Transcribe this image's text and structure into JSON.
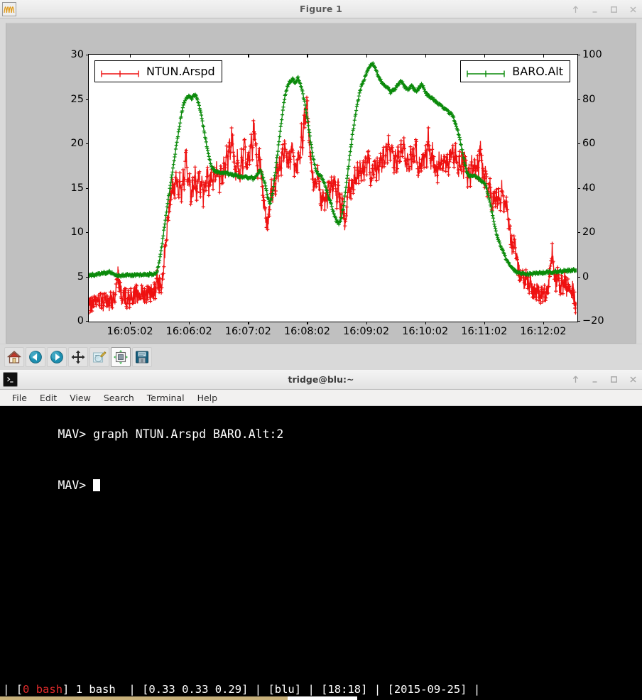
{
  "figure_window": {
    "title": "Figure 1",
    "app_icon": "waveform-icon",
    "controls": [
      "shade-icon",
      "minimize-icon",
      "maximize-icon",
      "close-icon"
    ],
    "toolbar": {
      "buttons": [
        {
          "name": "home-button",
          "icon": "home-icon",
          "tooltip": "Reset original view"
        },
        {
          "name": "back-button",
          "icon": "arrow-left-icon",
          "tooltip": "Back to previous view"
        },
        {
          "name": "forward-button",
          "icon": "arrow-right-icon",
          "tooltip": "Forward to next view"
        },
        {
          "name": "pan-button",
          "icon": "move-cross-icon",
          "tooltip": "Pan axes with left mouse"
        },
        {
          "name": "zoom-button",
          "icon": "zoom-rect-icon",
          "tooltip": "Zoom to rectangle"
        },
        {
          "name": "subplots-button",
          "icon": "configure-subplots-icon",
          "tooltip": "Configure subplots"
        },
        {
          "name": "save-button",
          "icon": "floppy-disk-icon",
          "tooltip": "Save the figure"
        }
      ]
    }
  },
  "chart_data": {
    "type": "line",
    "title": "",
    "xlabel": "",
    "ylabel": "",
    "grid": false,
    "x_tick_labels": [
      "16:05:02",
      "16:06:02",
      "16:07:02",
      "16:08:02",
      "16:09:02",
      "16:10:02",
      "16:11:02",
      "16:12:02"
    ],
    "x_tick_positions": [
      0.0845,
      0.2055,
      0.3265,
      0.4475,
      0.5685,
      0.6895,
      0.8105,
      0.9315
    ],
    "left_axis": {
      "label": "NTUN.Arspd",
      "ticks": [
        0,
        5,
        10,
        15,
        20,
        25,
        30
      ],
      "ylim": [
        0,
        30
      ],
      "color": "#ee1111"
    },
    "right_axis": {
      "label": "BARO.Alt",
      "ticks": [
        -20,
        0,
        20,
        40,
        60,
        80,
        100
      ],
      "ylim": [
        -20,
        100
      ],
      "color": "#0a8a0a"
    },
    "legend": [
      {
        "name": "NTUN.Arspd",
        "color": "#ee1111",
        "position": "upper-left",
        "marker": "plus"
      },
      {
        "name": "BARO.Alt",
        "color": "#0a8a0a",
        "position": "upper-right",
        "marker": "plus"
      }
    ],
    "series": [
      {
        "name": "NTUN.Arspd",
        "axis": "left",
        "color": "#ee1111",
        "marker": "plus",
        "noise": 1.05,
        "values": [
          1.8,
          2.0,
          1.7,
          2.2,
          1.9,
          2.3,
          1.8,
          2.1,
          2.4,
          2.0,
          2.2,
          1.9,
          2.5,
          2.1,
          2.3,
          2.0,
          2.6,
          2.2,
          2.4,
          2.1,
          4.2,
          5.5,
          4.6,
          3.6,
          2.9,
          2.6,
          3.0,
          2.7,
          2.4,
          2.8,
          2.5,
          2.9,
          2.6,
          3.0,
          2.7,
          3.1,
          2.8,
          2.5,
          2.9,
          3.2,
          3.0,
          2.7,
          3.1,
          2.8,
          3.2,
          2.9,
          3.3,
          3.0,
          3.4,
          3.6,
          4.8,
          3.9,
          4.4,
          3.8,
          5.0,
          6.6,
          8.2,
          9.8,
          11.4,
          12.8,
          13.9,
          14.8,
          15.6,
          14.2,
          16.0,
          15.2,
          14.6,
          15.9,
          13.4,
          16.8,
          15.0,
          19.6,
          17.2,
          14.8,
          16.4,
          13.6,
          15.8,
          14.4,
          16.6,
          14.0,
          15.4,
          16.2,
          14.6,
          15.8,
          13.9,
          16.0,
          15.2,
          17.1,
          14.4,
          15.9,
          16.8,
          14.9,
          16.3,
          15.5,
          17.4,
          16.0,
          14.8,
          16.9,
          15.6,
          17.8,
          16.2,
          19.0,
          17.4,
          20.6,
          18.2,
          21.4,
          19.0,
          17.6,
          16.2,
          18.4,
          17.0,
          15.8,
          18.8,
          17.2,
          20.2,
          18.6,
          16.8,
          19.4,
          17.8,
          21.0,
          19.2,
          22.6,
          20.4,
          18.6,
          17.0,
          19.2,
          17.4,
          15.6,
          14.0,
          12.6,
          11.4,
          10.2,
          12.0,
          13.6,
          15.2,
          14.0,
          16.2,
          15.0,
          17.4,
          16.0,
          18.2,
          16.8,
          19.6,
          18.0,
          20.4,
          18.8,
          17.2,
          19.0,
          17.6,
          20.0,
          18.4,
          16.8,
          18.6,
          17.0,
          19.4,
          18.0,
          21.2,
          19.6,
          23.4,
          21.8,
          24.8,
          22.4,
          20.0,
          18.4,
          16.6,
          15.0,
          16.4,
          15.2,
          17.0,
          15.6,
          14.2,
          12.8,
          14.4,
          13.0,
          15.0,
          13.6,
          15.4,
          14.0,
          16.0,
          14.6,
          16.4,
          15.0,
          13.4,
          15.2,
          13.8,
          12.4,
          13.8,
          12.2,
          11.0,
          12.4,
          13.8,
          15.2,
          14.0,
          16.0,
          14.8,
          16.8,
          15.4,
          17.2,
          15.8,
          17.6,
          16.2,
          18.0,
          16.6,
          18.4,
          17.0,
          19.0,
          17.4,
          15.8,
          17.4,
          16.0,
          17.8,
          16.4,
          18.2,
          16.8,
          18.6,
          17.2,
          19.2,
          17.8,
          19.6,
          18.2,
          20.0,
          18.4,
          20.4,
          18.8,
          17.2,
          18.8,
          17.4,
          19.2,
          17.8,
          19.6,
          18.0,
          20.2,
          18.6,
          17.0,
          18.6,
          17.2,
          19.0,
          17.6,
          19.4,
          18.0,
          20.0,
          18.4,
          16.8,
          18.4,
          17.0,
          18.8,
          17.4,
          19.2,
          17.6,
          21.2,
          19.4,
          17.8,
          19.4,
          18.0,
          16.4,
          18.0,
          16.6,
          18.2,
          16.8,
          18.4,
          17.0,
          18.6,
          17.2,
          18.8,
          17.4,
          19.0,
          17.6,
          19.2,
          17.8,
          19.4,
          18.0,
          16.4,
          18.2,
          16.8,
          18.4,
          17.0,
          18.6,
          17.2,
          16.0,
          17.4,
          16.2,
          17.8,
          16.4,
          18.0,
          16.6,
          18.2,
          16.8,
          20.2,
          18.4,
          16.8,
          15.4,
          16.8,
          15.4,
          14.2,
          15.6,
          14.2,
          13.0,
          14.4,
          13.0,
          14.6,
          13.2,
          14.8,
          13.4,
          15.0,
          13.6,
          12.4,
          13.8,
          12.6,
          11.4,
          10.2,
          9.0,
          8.0,
          9.2,
          8.2,
          7.2,
          6.2,
          5.4,
          4.6,
          5.8,
          4.8,
          4.0,
          5.0,
          4.2,
          3.4,
          4.4,
          3.6,
          2.8,
          3.8,
          3.0,
          4.0,
          3.2,
          2.4,
          3.4,
          2.6,
          3.6,
          2.8,
          4.0,
          3.2,
          5.4,
          6.8,
          8.2,
          6.6,
          5.0,
          4.2,
          5.4,
          4.4,
          3.6,
          4.6,
          3.8,
          4.8,
          4.0,
          3.2,
          4.2,
          3.4,
          2.6,
          3.6,
          2.8,
          2.0,
          1.4
        ]
      },
      {
        "name": "BARO.Alt",
        "axis": "right",
        "color": "#0a8a0a",
        "marker": "plus",
        "noise": 0.6,
        "values": [
          0.5,
          0.8,
          0.6,
          1.0,
          0.7,
          1.2,
          0.9,
          1.4,
          1.0,
          1.6,
          1.2,
          1.8,
          1.4,
          2.0,
          1.6,
          2.2,
          1.8,
          1.5,
          1.2,
          1.0,
          0.8,
          0.6,
          0.4,
          0.5,
          0.3,
          0.6,
          0.4,
          0.7,
          0.5,
          0.8,
          0.6,
          0.4,
          0.7,
          0.5,
          0.8,
          0.6,
          0.9,
          0.7,
          1.0,
          0.8,
          0.6,
          0.9,
          0.7,
          1.0,
          0.8,
          1.1,
          0.9,
          1.2,
          1.0,
          1.4,
          2.2,
          4.0,
          7.0,
          11.0,
          15.0,
          19.5,
          24.0,
          28.5,
          33.0,
          37.0,
          41.0,
          45.0,
          49.0,
          53.0,
          57.0,
          61.0,
          65.0,
          69.0,
          72.5,
          75.5,
          78.0,
          79.5,
          80.5,
          81.0,
          81.5,
          81.0,
          80.0,
          81.5,
          82.0,
          81.0,
          79.5,
          77.5,
          75.0,
          72.0,
          68.5,
          65.0,
          61.5,
          58.0,
          55.0,
          52.5,
          50.5,
          49.0,
          48.0,
          47.5,
          47.0,
          47.2,
          47.0,
          46.8,
          47.0,
          46.5,
          46.8,
          46.2,
          46.5,
          46.0,
          46.3,
          45.8,
          46.0,
          45.5,
          45.8,
          45.2,
          45.6,
          45.0,
          45.4,
          44.8,
          45.2,
          44.6,
          45.0,
          44.4,
          44.8,
          44.2,
          44.6,
          44.0,
          44.5,
          45.0,
          46.0,
          47.0,
          48.0,
          47.0,
          45.0,
          43.0,
          41.0,
          38.0,
          35.0,
          33.0,
          34.0,
          37.0,
          41.0,
          46.0,
          51.0,
          56.0,
          61.0,
          66.0,
          71.0,
          76.0,
          80.0,
          83.0,
          85.5,
          87.0,
          88.0,
          88.5,
          89.0,
          88.0,
          87.0,
          88.5,
          89.5,
          88.0,
          86.0,
          84.0,
          81.0,
          78.0,
          74.0,
          70.0,
          66.0,
          62.0,
          58.0,
          54.0,
          51.0,
          48.5,
          47.0,
          46.0,
          45.5,
          45.0,
          44.0,
          42.5,
          41.0,
          39.0,
          37.0,
          35.0,
          33.0,
          31.0,
          29.0,
          27.0,
          25.5,
          24.5,
          24.0,
          25.0,
          27.0,
          30.0,
          34.0,
          39.0,
          44.0,
          49.0,
          54.0,
          59.0,
          64.0,
          68.0,
          72.0,
          76.0,
          79.0,
          82.0,
          84.5,
          86.5,
          88.0,
          89.5,
          91.0,
          92.5,
          94.0,
          95.0,
          95.5,
          96.0,
          95.0,
          93.5,
          92.0,
          90.5,
          89.0,
          88.0,
          87.0,
          86.5,
          86.0,
          85.5,
          85.0,
          84.0,
          83.0,
          83.5,
          84.0,
          84.5,
          85.0,
          86.0,
          87.0,
          87.5,
          88.0,
          87.0,
          86.0,
          85.0,
          84.5,
          84.0,
          85.0,
          86.0,
          85.5,
          85.0,
          84.0,
          83.0,
          84.0,
          85.0,
          86.0,
          86.5,
          85.5,
          84.0,
          83.0,
          82.0,
          81.5,
          81.0,
          80.5,
          80.0,
          79.5,
          79.0,
          78.5,
          78.0,
          77.5,
          77.0,
          76.5,
          76.0,
          75.5,
          75.0,
          74.5,
          74.0,
          73.5,
          73.0,
          72.0,
          70.5,
          69.0,
          67.0,
          64.5,
          62.0,
          59.0,
          56.0,
          53.0,
          50.0,
          47.5,
          46.0,
          45.5,
          45.0,
          45.5,
          46.0,
          45.5,
          45.0,
          44.5,
          44.0,
          43.5,
          43.0,
          42.5,
          42.0,
          41.0,
          39.0,
          36.5,
          34.0,
          31.0,
          28.0,
          25.0,
          22.0,
          19.5,
          17.5,
          15.5,
          14.0,
          12.5,
          11.0,
          9.5,
          8.0,
          7.0,
          6.0,
          5.0,
          4.0,
          3.5,
          3.0,
          2.5,
          2.0,
          1.8,
          1.5,
          1.3,
          1.2,
          1.0,
          1.2,
          1.0,
          1.3,
          1.1,
          1.4,
          1.2,
          1.5,
          1.3,
          1.6,
          1.4,
          1.7,
          1.5,
          1.8,
          1.6,
          1.9,
          1.7,
          2.0,
          1.8,
          2.1,
          1.9,
          2.2,
          2.0,
          2.3,
          2.1,
          2.4,
          2.2,
          2.5,
          2.3,
          2.6,
          2.4,
          2.7,
          2.5,
          2.8,
          2.6,
          2.9,
          2.7,
          3.0,
          2.8,
          2.6
        ]
      }
    ]
  },
  "terminal_window": {
    "title": "tridge@blu:~",
    "app_icon": "terminal-icon",
    "controls": [
      "shade-icon",
      "minimize-icon",
      "maximize-icon",
      "close-icon"
    ],
    "menus": [
      "File",
      "Edit",
      "View",
      "Search",
      "Terminal",
      "Help"
    ],
    "lines": [
      {
        "prompt": "MAV> ",
        "command": "graph NTUN.Arspd BARO.Alt:2"
      },
      {
        "prompt": "MAV> ",
        "command": ""
      }
    ],
    "cursor": "block-cursor",
    "status_bar": {
      "sep": "|",
      "window_open": "[",
      "window_index": "0",
      "window_name": " bash",
      "window_close": "]",
      "window_list": "1 bash",
      "load": "[0.33 0.33 0.29]",
      "host": "[blu]",
      "time": "[18:18]",
      "date": "[2015-09-25]",
      "index_color": "#e02b2b"
    }
  }
}
